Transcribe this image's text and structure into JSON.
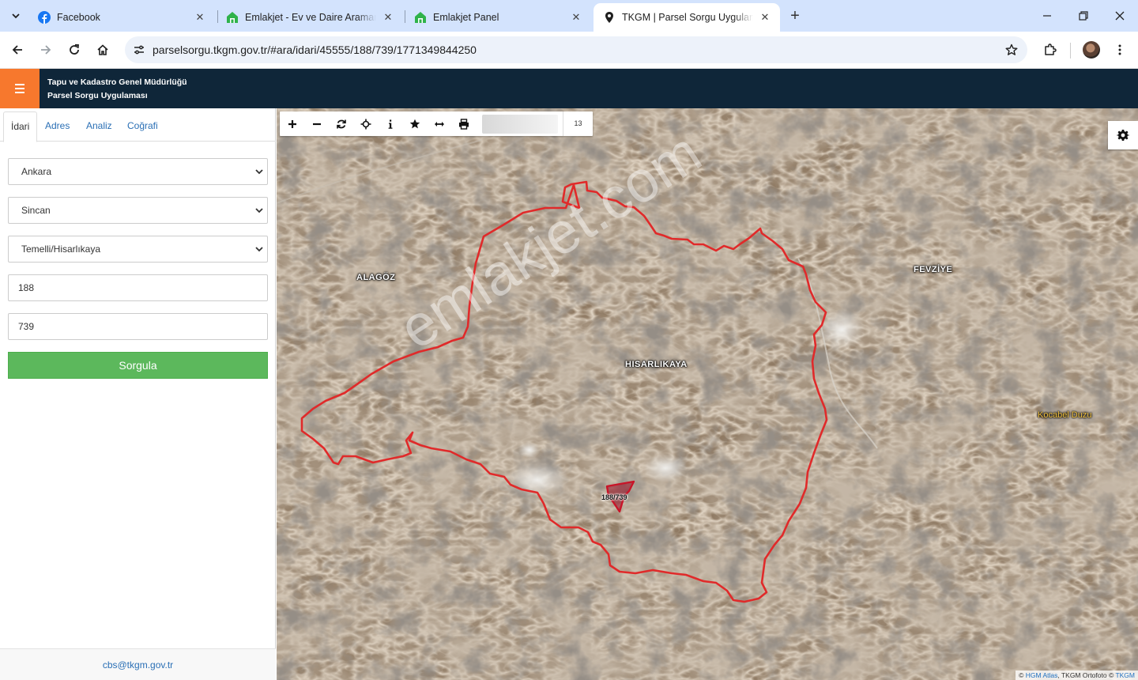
{
  "browser": {
    "tabs": [
      {
        "title": "Facebook",
        "icon": "facebook-icon",
        "active": false
      },
      {
        "title": "Emlakjet - Ev ve Daire Aramanın",
        "icon": "emlakjet-house-icon",
        "active": false
      },
      {
        "title": "Emlakjet Panel",
        "icon": "emlakjet-house-icon",
        "active": false
      },
      {
        "title": "TKGM | Parsel Sorgu Uygulaması",
        "icon": "location-pin-icon",
        "active": true
      }
    ],
    "url": "parselsorgu.tkgm.gov.tr/#ara/idari/45555/188/739/1771349844250"
  },
  "app": {
    "title_line1": "Tapu ve Kadastro Genel Müdürlüğü",
    "title_line2": "Parsel Sorgu Uygulaması"
  },
  "panel": {
    "tabs": [
      "İdari",
      "Adres",
      "Analiz",
      "Coğrafi"
    ],
    "active_tab": "İdari",
    "province": "Ankara",
    "district": "Sincan",
    "neighborhood": "Temelli/Hisarlıkaya",
    "block_no": "188",
    "parcel_no": "739",
    "query_button": "Sorgula",
    "contact_email": "cbs@tkgm.gov.tr"
  },
  "map": {
    "zoom_level": "13",
    "labels": {
      "alagoz": "ALAGÖZ",
      "fevziye": "FEVZİYE",
      "hisarlikaya": "HISARLIKAYA",
      "kocabel": "Kocabel Duzu"
    },
    "parcel_label": "188/739",
    "watermark": "emlakjet.com",
    "attribution": {
      "prefix": "©",
      "hgm": "HGM Atlas",
      "middle": ", TKGM Ortofoto ©",
      "tkgm": "TKGM"
    },
    "boundary_color": "#e02a2a",
    "parcel_color": "#9b1020"
  }
}
